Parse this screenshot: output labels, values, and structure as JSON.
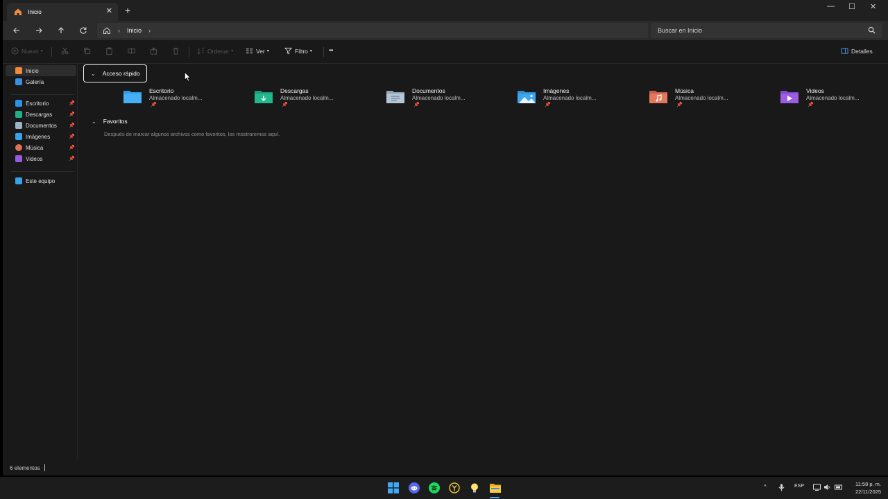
{
  "tab": {
    "title": "Inicio",
    "close": "✕",
    "new": "+"
  },
  "window_controls": {
    "minimize": "—",
    "maximize": "☐",
    "close": "✕"
  },
  "address": {
    "crumb": "Inicio",
    "separator": "›",
    "trailing": "›"
  },
  "search": {
    "placeholder": "Buscar en Inicio"
  },
  "commandbar": {
    "new_label": "Nuevo",
    "sort_label": "Ordenar",
    "view_label": "Ver",
    "filter_label": "Filtro",
    "more_label": "•••",
    "details_label": "Detalles"
  },
  "sidebar": {
    "top": [
      {
        "label": "Inicio",
        "color": "#f08a3c",
        "icon": "home-icon"
      },
      {
        "label": "Galería",
        "color": "#3a8fe0",
        "icon": "gallery-icon"
      }
    ],
    "pinned": [
      {
        "label": "Escritorio",
        "color": "#2f8fe6",
        "icon": "desktop-folder-icon",
        "pin": "📌"
      },
      {
        "label": "Descargas",
        "color": "#1fb08a",
        "icon": "downloads-icon",
        "pin": "📌"
      },
      {
        "label": "Documentos",
        "color": "#9bb4c8",
        "icon": "documents-icon",
        "pin": "📌"
      },
      {
        "label": "Imágenes",
        "color": "#3aa0e8",
        "icon": "pictures-icon",
        "pin": "📌"
      },
      {
        "label": "Música",
        "color": "#e0705a",
        "icon": "music-icon",
        "pin": "📌"
      },
      {
        "label": "Videos",
        "color": "#9a5ae0",
        "icon": "videos-icon",
        "pin": "📌"
      }
    ],
    "this_pc": {
      "label": "Este equipo",
      "color": "#3aa0e8",
      "icon": "computer-icon"
    }
  },
  "quick_access": {
    "heading": "Acceso rápido",
    "chevron": "⌄",
    "items": [
      {
        "name": "Escritorio",
        "sub": "Almacenado localm...",
        "color": "#2f9be8",
        "icon": "desktop-folder-icon",
        "pin": "📌"
      },
      {
        "name": "Descargas",
        "sub": "Almacenado localm...",
        "color": "#1fb38a",
        "icon": "downloads-folder-icon",
        "pin": "📌"
      },
      {
        "name": "Documentos",
        "sub": "Almacenado localm...",
        "color": "#a9bccc",
        "icon": "documents-folder-icon",
        "pin": "📌"
      },
      {
        "name": "Imágenes",
        "sub": "Almacenado localm...",
        "color": "#3ea6ec",
        "icon": "pictures-folder-icon",
        "pin": "📌"
      },
      {
        "name": "Música",
        "sub": "Almacenado localm...",
        "color": "#e2785e",
        "icon": "music-folder-icon",
        "pin": "📌"
      },
      {
        "name": "Videos",
        "sub": "Almacenado localm...",
        "color": "#9c5de2",
        "icon": "videos-folder-icon",
        "pin": "📌"
      }
    ]
  },
  "favorites": {
    "heading": "Favoritos",
    "chevron": "⌄",
    "empty_text": "Después de marcar algunos archivos como favoritos, los mostraremos aquí."
  },
  "status": {
    "count": "6 elementos"
  },
  "taskbar": {
    "apps": [
      "windows-start-icon",
      "discord-icon",
      "spotify-icon",
      "app-icon",
      "lightbulb-icon",
      "file-explorer-icon"
    ],
    "tray": {
      "chevron": "^",
      "lang": "ESP"
    },
    "clock": {
      "time": "11:58 p. m.",
      "date": "22/11/2025"
    }
  }
}
